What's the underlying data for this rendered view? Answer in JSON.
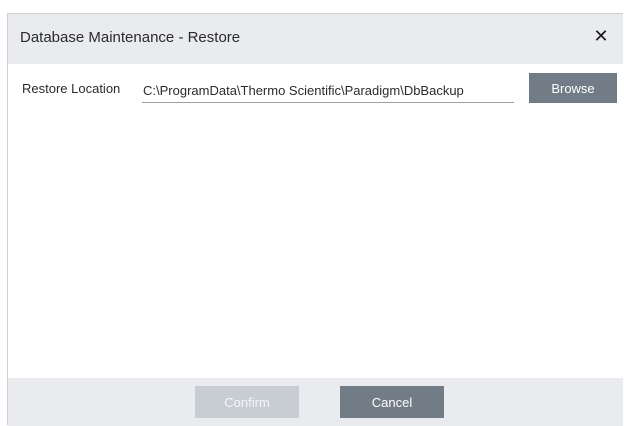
{
  "dialog": {
    "title": "Database Maintenance - Restore",
    "close_icon": "close-icon"
  },
  "restore": {
    "label": "Restore Location",
    "path_value": "C:\\ProgramData\\Thermo Scientific\\Paradigm\\DbBackup",
    "browse_label": "Browse"
  },
  "footer": {
    "confirm_label": "Confirm",
    "confirm_enabled": false,
    "cancel_label": "Cancel"
  },
  "colors": {
    "header_bg": "#e9ebee",
    "button_bg": "#727c86",
    "disabled_button_bg": "#c7cdd3"
  }
}
